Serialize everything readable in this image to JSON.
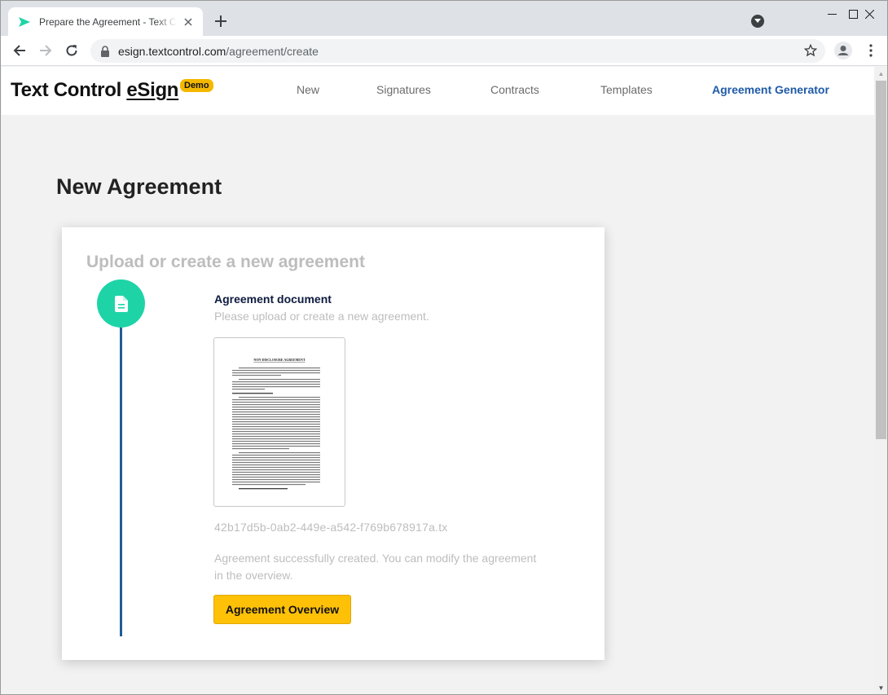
{
  "browser": {
    "tab_title": "Prepare the Agreement - Text Control eSign",
    "new_tab_icon": "plus-icon",
    "url_host": "esign.textcontrol.com",
    "url_path": "/agreement/create",
    "window_controls": [
      "minimize",
      "maximize",
      "close"
    ]
  },
  "navbar": {
    "brand_prefix": "Text Control ",
    "brand_esign": "eSign",
    "badge": "Demo",
    "items": [
      {
        "label": "New",
        "active": false
      },
      {
        "label": "Signatures",
        "active": false
      },
      {
        "label": "Contracts",
        "active": false
      },
      {
        "label": "Templates",
        "active": false
      },
      {
        "label": "Agreement Generator",
        "active": true
      }
    ]
  },
  "main": {
    "page_title": "New Agreement",
    "card": {
      "title": "Upload or create a new agreement",
      "step_icon": "document-icon",
      "step_heading": "Agreement document",
      "step_subtext": "Please upload or create a new agreement.",
      "document_heading": "NON-DISCLOSURE AGREEMENT",
      "filename": "42b17d5b-0ab2-449e-a542-f769b678917a.tx",
      "success_message": "Agreement successfully created. You can modify the agreement in the overview.",
      "button_label": "Agreement Overview"
    }
  },
  "colors": {
    "accent_green": "#1ed4a7",
    "step_line_blue": "#215b97",
    "button_yellow": "#ffc107",
    "active_nav_blue": "#1e5aa8",
    "badge_yellow": "#f5b800"
  }
}
